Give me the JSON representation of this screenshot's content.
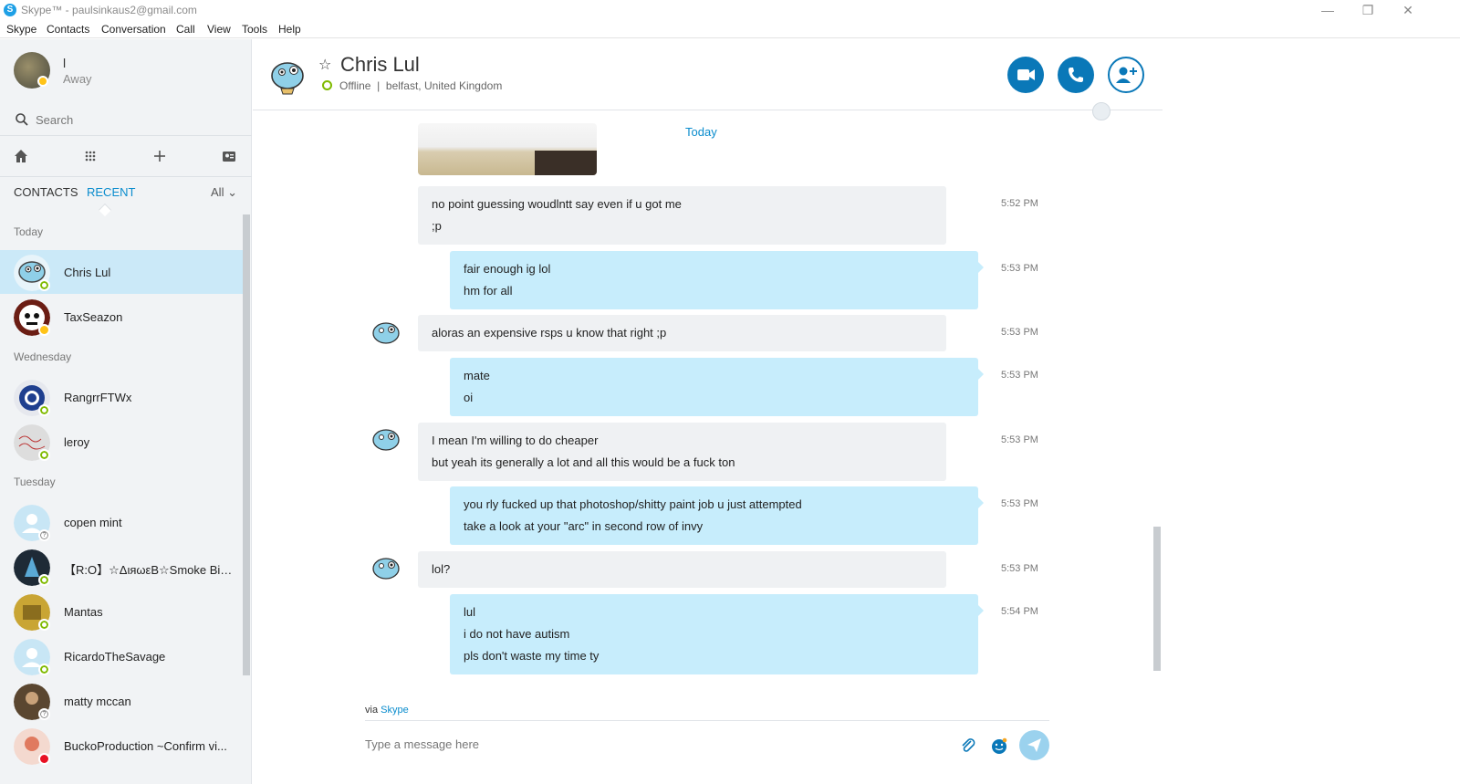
{
  "window": {
    "title": "Skype™ - paulsinkaus2@gmail.com",
    "logo": "S"
  },
  "menu": [
    "Skype",
    "Contacts",
    "Conversation",
    "Call",
    "View",
    "Tools",
    "Help"
  ],
  "me": {
    "name": "l",
    "status": "Away"
  },
  "search": {
    "placeholder": "Search"
  },
  "tabs": {
    "contacts": "CONTACTS",
    "recent": "RECENT",
    "filter": "All"
  },
  "sections": {
    "today": "Today",
    "wednesday": "Wednesday",
    "tuesday": "Tuesday"
  },
  "contacts": [
    {
      "name": "Chris Lul",
      "status": "online"
    },
    {
      "name": "TaxSeazon",
      "status": "away"
    },
    {
      "name": "RangrrFTWx",
      "status": "online"
    },
    {
      "name": "leroy",
      "status": "online"
    },
    {
      "name": "copen mint",
      "status": "unknown"
    },
    {
      "name": "【R:O】☆ΔιяωεΒ☆Smoke Big【...",
      "status": "online"
    },
    {
      "name": "Mantas",
      "status": "online"
    },
    {
      "name": "RicardoTheSavage",
      "status": "online"
    },
    {
      "name": "matty mccan",
      "status": "unknown"
    },
    {
      "name": "BuckoProduction ~Confirm vi...",
      "status": "dnd"
    }
  ],
  "chat": {
    "name": "Chris Lul",
    "status": "Offline",
    "location": "belfast, United Kingdom",
    "day_label": "Today",
    "messages": [
      {
        "dir": "in",
        "lines": [
          "no point guessing woudlntt say even if u got me",
          ";p"
        ],
        "time": "5:52 PM"
      },
      {
        "dir": "out",
        "lines": [
          "fair enough ig lol",
          "hm for all"
        ],
        "time": "5:53 PM"
      },
      {
        "dir": "in",
        "lines": [
          "aloras an expensive rsps u know that right ;p"
        ],
        "time": "5:53 PM"
      },
      {
        "dir": "out",
        "lines": [
          "mate",
          "oi"
        ],
        "time": "5:53 PM"
      },
      {
        "dir": "in",
        "lines": [
          "I mean I'm willing to do cheaper",
          "but yeah its generally a lot and all this would be a fuck ton"
        ],
        "time": "5:53 PM"
      },
      {
        "dir": "out",
        "lines": [
          "you rly fucked up that photoshop/shitty paint job u just attempted",
          "take a look at your \"arc\" in second row of invy"
        ],
        "time": "5:53 PM"
      },
      {
        "dir": "in",
        "lines": [
          "lol?"
        ],
        "time": "5:53 PM"
      },
      {
        "dir": "out",
        "lines": [
          "lul",
          "i do not have autism",
          "pls don't waste my time ty"
        ],
        "time": "5:54 PM"
      }
    ]
  },
  "composer": {
    "via_prefix": "via",
    "via_link": "Skype",
    "placeholder": "Type a message here"
  },
  "colors": {
    "accent": "#0a78b8",
    "link": "#0a8ccd",
    "outgoing_bubble": "#c7edfc",
    "incoming_bubble": "#eff1f3",
    "selected_row": "#cbe9f8"
  }
}
